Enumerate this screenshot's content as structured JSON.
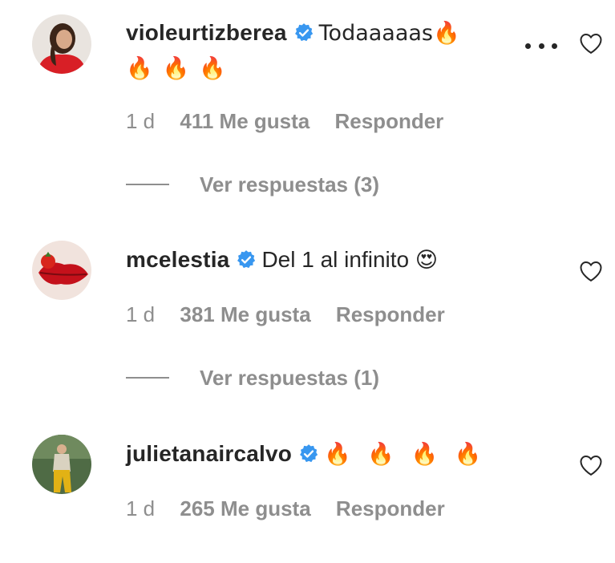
{
  "comments": [
    {
      "username": "violeurtizberea",
      "text": "Todaaaaas🔥",
      "extra_emojis": "🔥🔥🔥",
      "time": "1 d",
      "likes": "411 Me gusta",
      "reply": "Responder",
      "view_replies": "Ver respuestas (3)"
    },
    {
      "username": "mcelestia",
      "text": "Del 1 al infinito",
      "emoji": "😍",
      "time": "1 d",
      "likes": "381 Me gusta",
      "reply": "Responder",
      "view_replies": "Ver respuestas (1)"
    },
    {
      "username": "julietanaircalvo",
      "text": "🔥 🔥 🔥 🔥",
      "time": "1 d",
      "likes": "265 Me gusta",
      "reply": "Responder"
    }
  ],
  "colors": {
    "verified_blue": "#3897f0",
    "text": "#262626",
    "secondary": "#8e8e8e"
  },
  "icons": {
    "verified": "verified-badge-icon",
    "like": "heart-outline-icon",
    "options": "more-horizontal-icon"
  }
}
